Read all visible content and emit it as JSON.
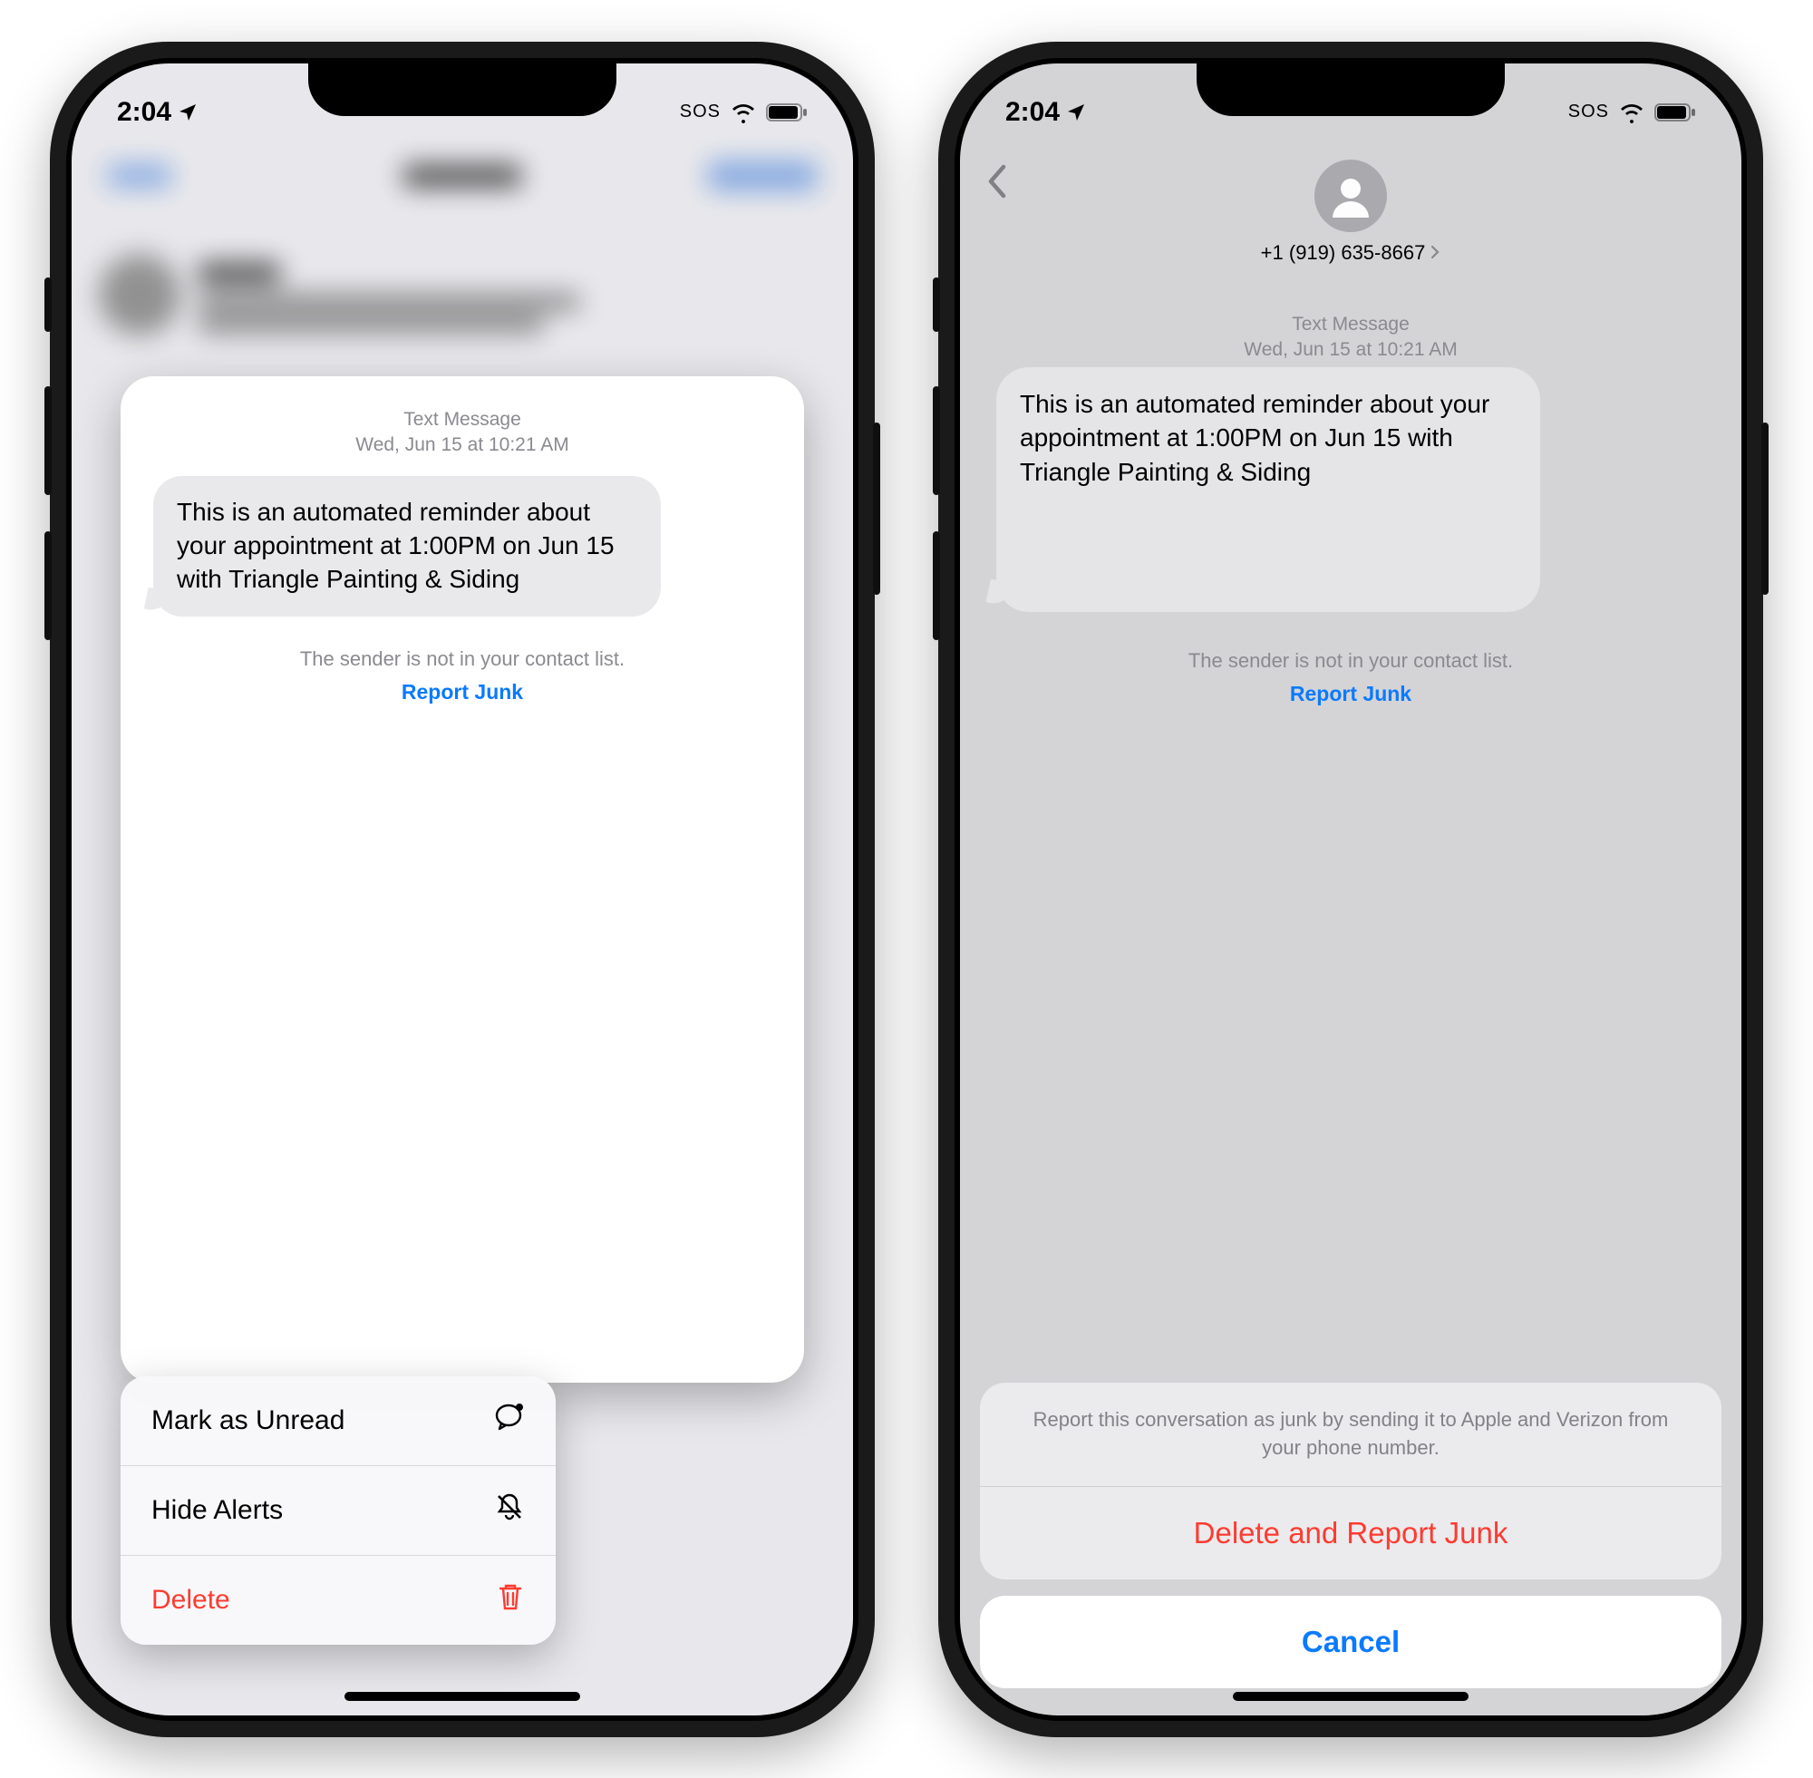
{
  "status": {
    "time": "2:04",
    "sos": "SOS"
  },
  "left": {
    "meta_label": "Text Message",
    "meta_time": "Wed, Jun 15 at 10:21 AM",
    "bubble": "This is an automated reminder about your appointment at 1:00PM on Jun 15 with Triangle Painting & Siding",
    "not_in_list": "The sender is not in your contact list.",
    "report_junk": "Report Junk",
    "menu": {
      "mark_unread": "Mark as Unread",
      "hide_alerts": "Hide Alerts",
      "delete": "Delete"
    }
  },
  "right": {
    "contact_number": "+1 (919) 635-8667",
    "meta_label": "Text Message",
    "meta_time": "Wed, Jun 15 at 10:21 AM",
    "bubble": "This is an automated reminder about your appointment at 1:00PM on Jun 15 with Triangle Painting & Siding",
    "not_in_list": "The sender is not in your contact list.",
    "report_junk": "Report Junk",
    "sheet": {
      "info": "Report this conversation as junk by sending it to Apple and Verizon from your phone number.",
      "delete_report": "Delete and Report Junk",
      "cancel": "Cancel"
    }
  }
}
